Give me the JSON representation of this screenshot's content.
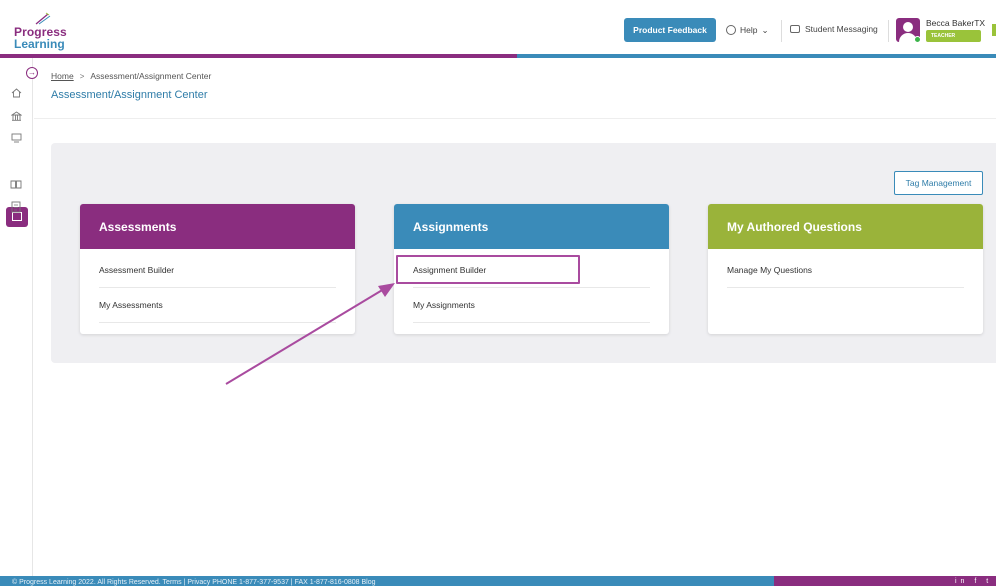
{
  "brand": {
    "line1": "Progress",
    "line2": "Learning"
  },
  "header": {
    "feedback_label": "Product Feedback",
    "help_label": "Help",
    "messaging_label": "Student Messaging",
    "user_name": "Becca BakerTX",
    "user_role": "TEACHER"
  },
  "breadcrumb": {
    "home": "Home",
    "separator": ">",
    "current": "Assessment/Assignment Center"
  },
  "page_title": "Assessment/Assignment Center",
  "tag_management_label": "Tag Management",
  "cards": [
    {
      "title": "Assessments",
      "color": "#8a2d7f",
      "links": [
        "Assessment Builder",
        "My Assessments"
      ]
    },
    {
      "title": "Assignments",
      "color": "#3a8bb9",
      "links": [
        "Assignment Builder",
        "My Assignments"
      ]
    },
    {
      "title": "My Authored Questions",
      "color": "#9ab33a",
      "links": [
        "Manage My Questions"
      ]
    }
  ],
  "sidebar_icons": [
    "home-icon",
    "school-icon",
    "classroom-icon",
    "book-open-icon",
    "library-icon",
    "report-icon"
  ],
  "footer": {
    "text": "© Progress Learning 2022. All Rights Reserved.   Terms   |   Privacy   PHONE 1-877-377-9537   |   FAX 1-877-816-0808   Blog",
    "social": "in f t"
  },
  "colors": {
    "purple": "#8a2d7f",
    "blue": "#3a8bb9",
    "green": "#9ac33a",
    "annotation": "#a94b9f"
  }
}
